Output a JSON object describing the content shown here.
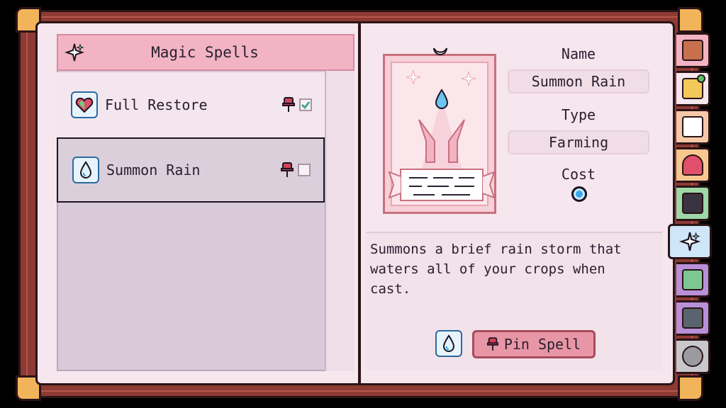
{
  "journal": {
    "section_title": "Magic Spells",
    "spells": [
      {
        "name": "Full Restore",
        "icon": "heart-gem-icon",
        "pinned": true
      },
      {
        "name": "Summon Rain",
        "icon": "water-drop-icon",
        "pinned": false
      }
    ]
  },
  "detail": {
    "name_label": "Name",
    "name_value": "Summon Rain",
    "type_label": "Type",
    "type_value": "Farming",
    "cost_label": "Cost",
    "description": "Summons a brief rain storm that waters all of your crops when cast.",
    "pin_button": "Pin Spell"
  },
  "tabs": [
    "backpack-icon",
    "outfit-icon",
    "mail-icon",
    "heart-icon",
    "pet-icon",
    "magic-sparkle-icon",
    "map-icon",
    "journal-icon",
    "gear-icon"
  ],
  "colors": {
    "book_cover": "#8e3a34",
    "page": "#f6e6ee",
    "header": "#f2b4c4",
    "accent_blue": "#3aa8f0",
    "pin_red": "#d0425a"
  }
}
